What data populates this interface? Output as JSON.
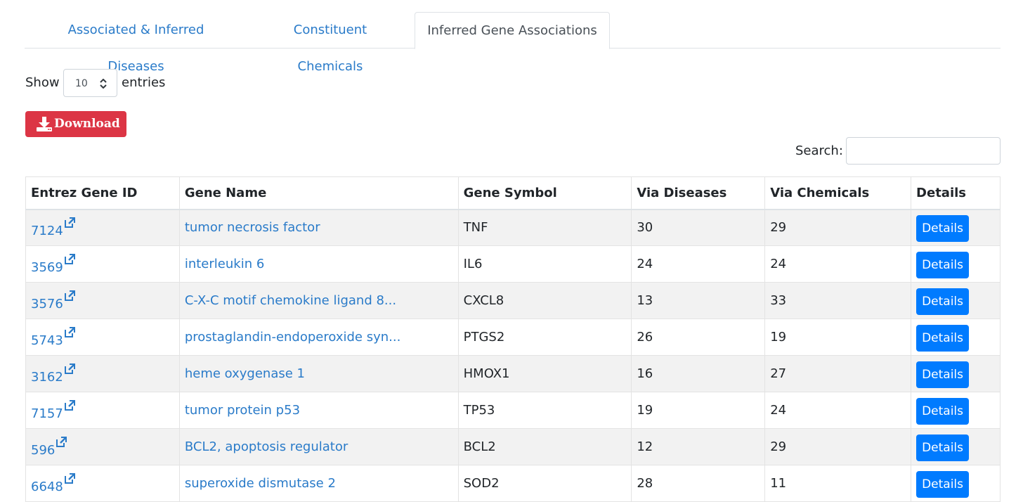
{
  "tabs": [
    {
      "label": "Associated & Inferred Diseases"
    },
    {
      "label": "Constituent Chemicals"
    },
    {
      "label": "Inferred Gene Associations"
    }
  ],
  "length": {
    "show_label": "Show",
    "value": "10",
    "entries_label": "entries"
  },
  "download": {
    "label": "Download"
  },
  "search": {
    "label": "Search:",
    "value": "",
    "placeholder": ""
  },
  "table": {
    "headers": [
      "Entrez Gene ID",
      "Gene Name",
      "Gene Symbol",
      "Via Diseases",
      "Via Chemicals",
      "Details"
    ],
    "rows": [
      {
        "id": "7124",
        "name": "tumor necrosis factor",
        "symbol": "TNF",
        "via_diseases": "30",
        "via_chemicals": "29",
        "details": "Details"
      },
      {
        "id": "3569",
        "name": "interleukin 6",
        "symbol": "IL6",
        "via_diseases": "24",
        "via_chemicals": "24",
        "details": "Details"
      },
      {
        "id": "3576",
        "name": "C-X-C motif chemokine ligand 8...",
        "symbol": "CXCL8",
        "via_diseases": "13",
        "via_chemicals": "33",
        "details": "Details"
      },
      {
        "id": "5743",
        "name": "prostaglandin-endoperoxide syn...",
        "symbol": "PTGS2",
        "via_diseases": "26",
        "via_chemicals": "19",
        "details": "Details"
      },
      {
        "id": "3162",
        "name": "heme oxygenase 1",
        "symbol": "HMOX1",
        "via_diseases": "16",
        "via_chemicals": "27",
        "details": "Details"
      },
      {
        "id": "7157",
        "name": "tumor protein p53",
        "symbol": "TP53",
        "via_diseases": "19",
        "via_chemicals": "24",
        "details": "Details"
      },
      {
        "id": "596",
        "name": "BCL2, apoptosis regulator",
        "symbol": "BCL2",
        "via_diseases": "12",
        "via_chemicals": "29",
        "details": "Details"
      },
      {
        "id": "6648",
        "name": "superoxide dismutase 2",
        "symbol": "SOD2",
        "via_diseases": "28",
        "via_chemicals": "11",
        "details": "Details"
      }
    ]
  },
  "colors": {
    "link": "#2a7bc9",
    "download_button": "#dc3545",
    "details_button": "#007bff"
  },
  "icons": {
    "download": "download-icon",
    "external_link": "external-link-icon",
    "select_arrows": "sort-arrows-icon"
  }
}
